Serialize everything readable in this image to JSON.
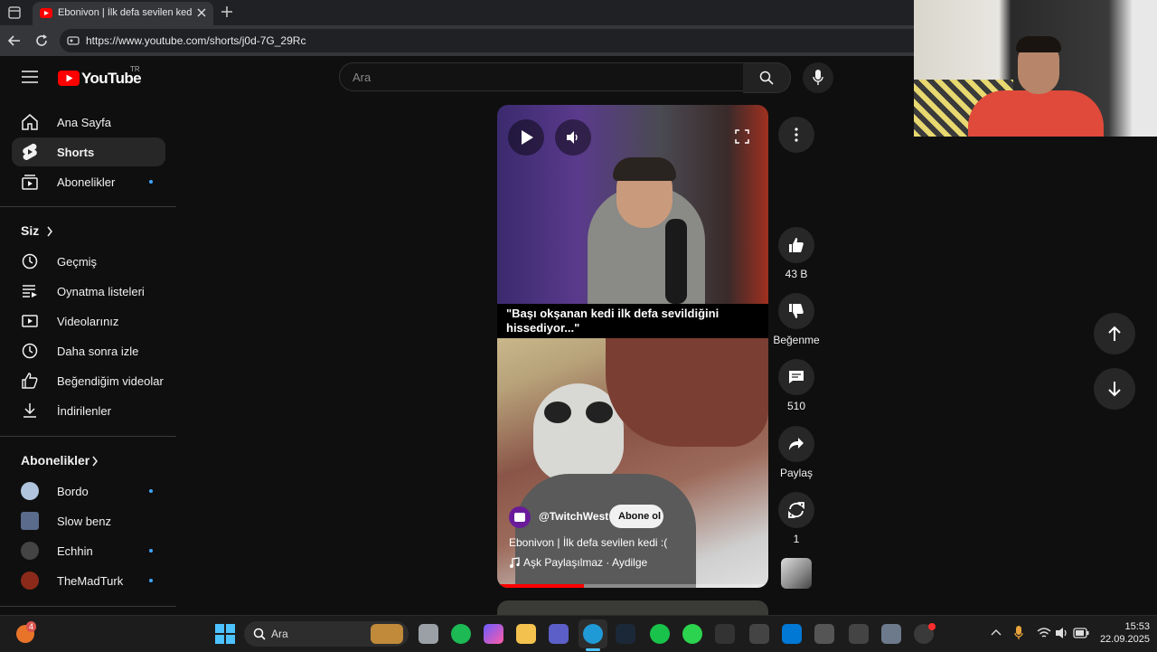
{
  "browser": {
    "tab_title": "Ebonivon | İlk defa sevilen kedi :(",
    "url": "https://www.youtube.com/shorts/j0d-7G_29Rc"
  },
  "youtube": {
    "logo_text": "YouTube",
    "region": "TR",
    "search_placeholder": "Ara",
    "sidebar": {
      "main": [
        {
          "label": "Ana Sayfa",
          "icon": "home-icon"
        },
        {
          "label": "Shorts",
          "icon": "shorts-icon"
        },
        {
          "label": "Abonelikler",
          "icon": "subscriptions-icon"
        }
      ],
      "you_header": "Siz",
      "you": [
        {
          "label": "Geçmiş",
          "icon": "history-icon"
        },
        {
          "label": "Oynatma listeleri",
          "icon": "playlists-icon"
        },
        {
          "label": "Videolarınız",
          "icon": "your-videos-icon"
        },
        {
          "label": "Daha sonra izle",
          "icon": "watch-later-icon"
        },
        {
          "label": "Beğendiğim videolar",
          "icon": "liked-videos-icon"
        },
        {
          "label": "İndirilenler",
          "icon": "downloads-icon"
        }
      ],
      "subs_header": "Abonelikler",
      "subs": [
        {
          "label": "Bordo",
          "color": "#b0c4de"
        },
        {
          "label": "Slow benz",
          "color": "#5a6b8c"
        },
        {
          "label": "Echhin",
          "color": "#444444"
        },
        {
          "label": "TheMadTurk",
          "color": "#8b2a1a"
        }
      ]
    },
    "short": {
      "caption": "\"Başı okşanan kedi ilk defa sevildiğini hissediyor...\"",
      "channel": "@TwitchWest",
      "subscribe_label": "Abone ol",
      "title": "Ebonivon | İlk defa sevilen kedi :(",
      "music": "Aşk Paylaşılmaz · Aydilge",
      "progress": 0.32
    },
    "actions": {
      "likes": "43 B",
      "dislike_label": "Beğenme",
      "comments": "510",
      "share_label": "Paylaş",
      "remix_count": "1"
    }
  },
  "taskbar": {
    "notification_badge": "4",
    "search_label": "Ara",
    "time": "15:53",
    "date": "22.09.2025"
  },
  "colors": {
    "youtube_red": "#ff0000",
    "accent_blue": "#3ea6ff",
    "background": "#0f0f0f"
  }
}
